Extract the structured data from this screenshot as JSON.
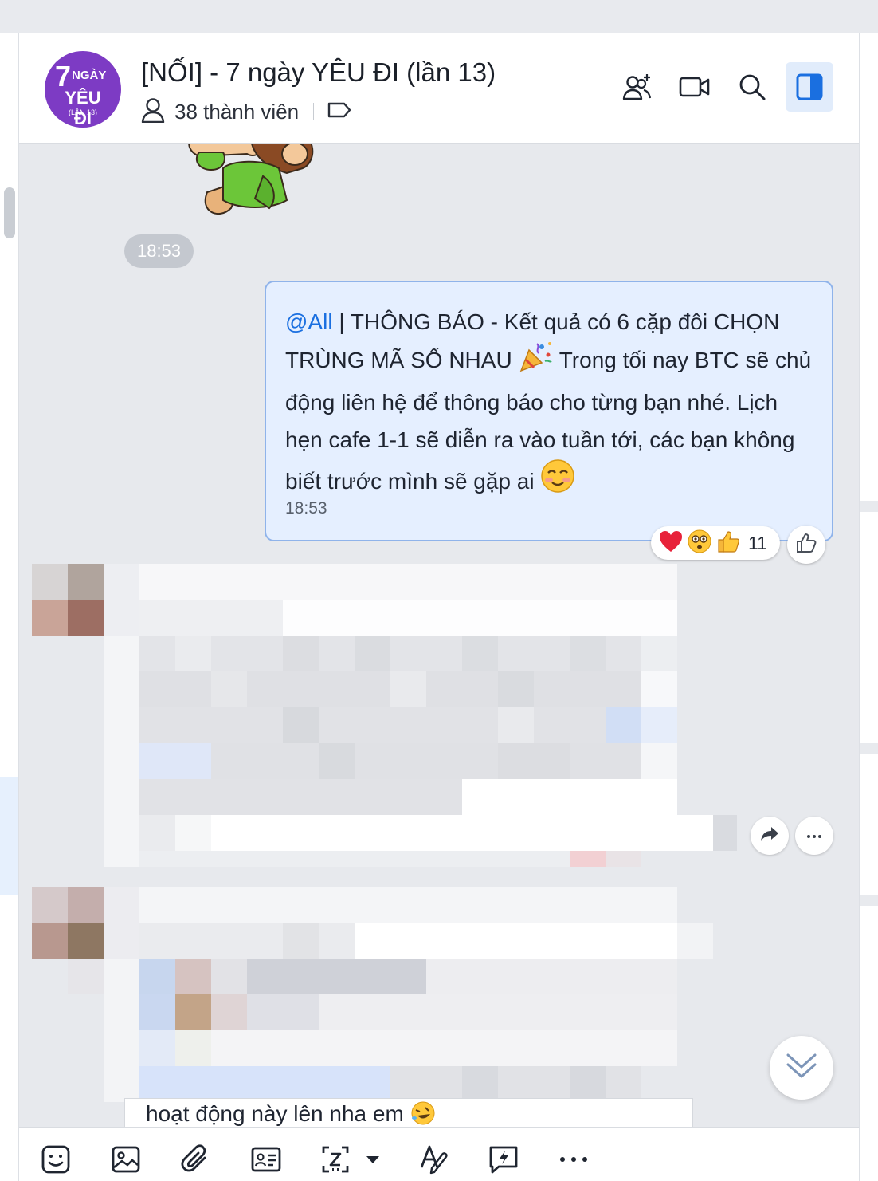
{
  "header": {
    "avatar_line1": "7",
    "avatar_line2": "NGÀY",
    "avatar_line3": "YÊU ĐI",
    "avatar_line4": "(LẦN 13)",
    "title": "[NỐI] - 7 ngày YÊU ĐI (lần 13)",
    "member_count": "38 thành viên",
    "icons": [
      "add-member-icon",
      "video-call-icon",
      "search-icon",
      "sidebar-toggle-icon"
    ],
    "active_icon": "sidebar-toggle-icon",
    "accent_color": "#1a6fe0"
  },
  "messages": {
    "sticker_time": "18:53",
    "announcement": {
      "mention": "@All",
      "text_1": " | THÔNG BÁO - Kết quả có 6 cặp đôi CHỌN TRÙNG MÃ SỐ NHAU ",
      "text_2": " Trong tối nay BTC sẽ chủ động liên hệ để thông báo cho từng bạn nhé. Lịch hẹn cafe 1-1 sẽ diễn ra vào tuần tới, các bạn không biết trước mình sẽ gặp ai ",
      "time": "18:53",
      "reactions": [
        "heart",
        "flushed-face",
        "thumbs-up"
      ],
      "reaction_count": "11"
    },
    "last_visible_text": "hoạt động này lên nha em "
  },
  "toolbar": {
    "icons": [
      "sticker-icon",
      "image-icon",
      "attach-icon",
      "contact-card-icon",
      "screenshot-icon",
      "text-format-icon",
      "quick-message-icon",
      "more-icon"
    ]
  }
}
